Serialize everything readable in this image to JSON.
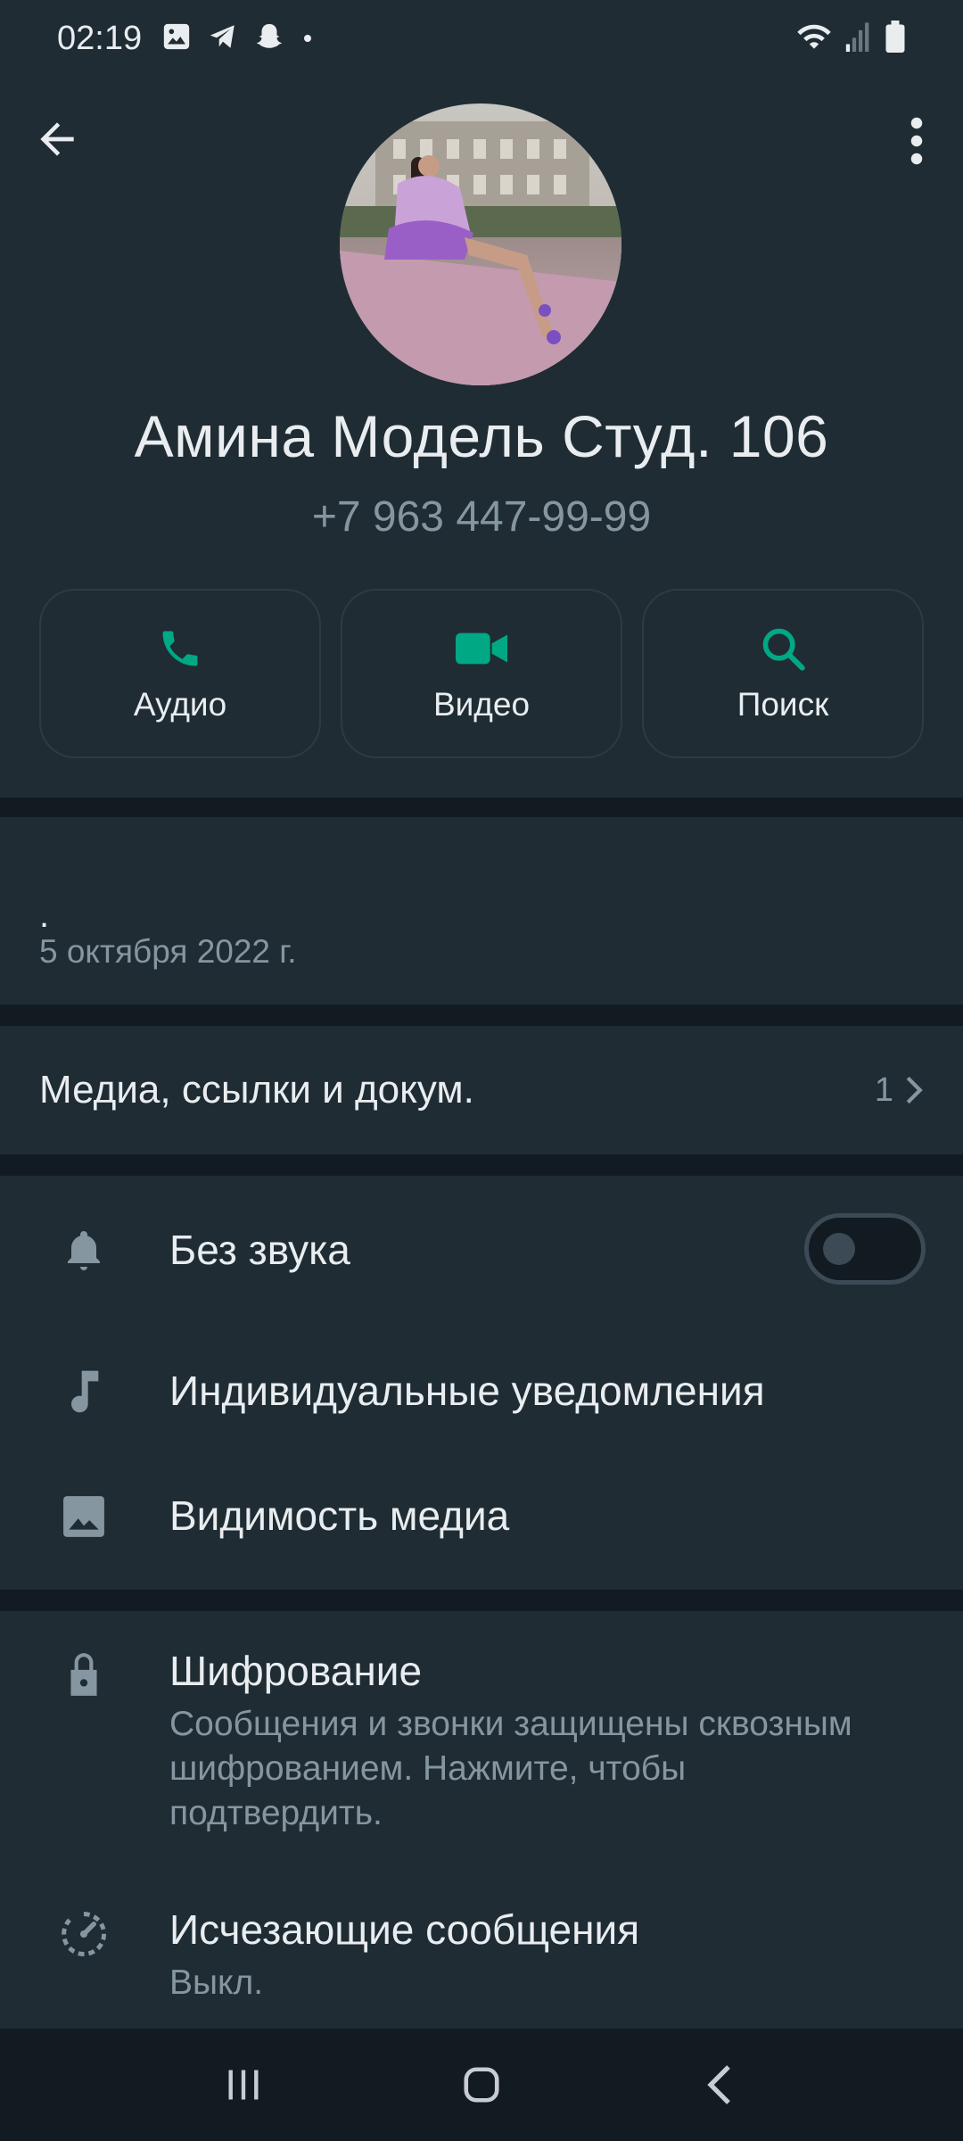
{
  "status_bar": {
    "time": "02:19"
  },
  "contact": {
    "name": "Амина Модель Студ. 106",
    "phone": "+7 963 447-99-99"
  },
  "actions": [
    {
      "label": "Аудио",
      "icon": "phone-icon"
    },
    {
      "label": "Видео",
      "icon": "video-icon"
    },
    {
      "label": "Поиск",
      "icon": "search-icon"
    }
  ],
  "about": {
    "text": ".",
    "date": "5 октября 2022 г."
  },
  "media": {
    "label": "Медиа, ссылки и докум.",
    "count": "1"
  },
  "settings": {
    "mute": {
      "label": "Без звука",
      "enabled": false
    },
    "custom_notifications": {
      "label": "Индивидуальные уведомления"
    },
    "media_visibility": {
      "label": "Видимость медиа"
    }
  },
  "security": {
    "encryption": {
      "title": "Шифрование",
      "subtitle": "Сообщения и звонки защищены сквозным шифрованием. Нажмите, чтобы подтвердить."
    },
    "disappearing": {
      "title": "Исчезающие сообщения",
      "subtitle": "Выкл."
    }
  },
  "colors": {
    "accent": "#00a884",
    "background": "#121b22",
    "surface": "#1f2c34",
    "secondary_text": "#8696a0"
  }
}
